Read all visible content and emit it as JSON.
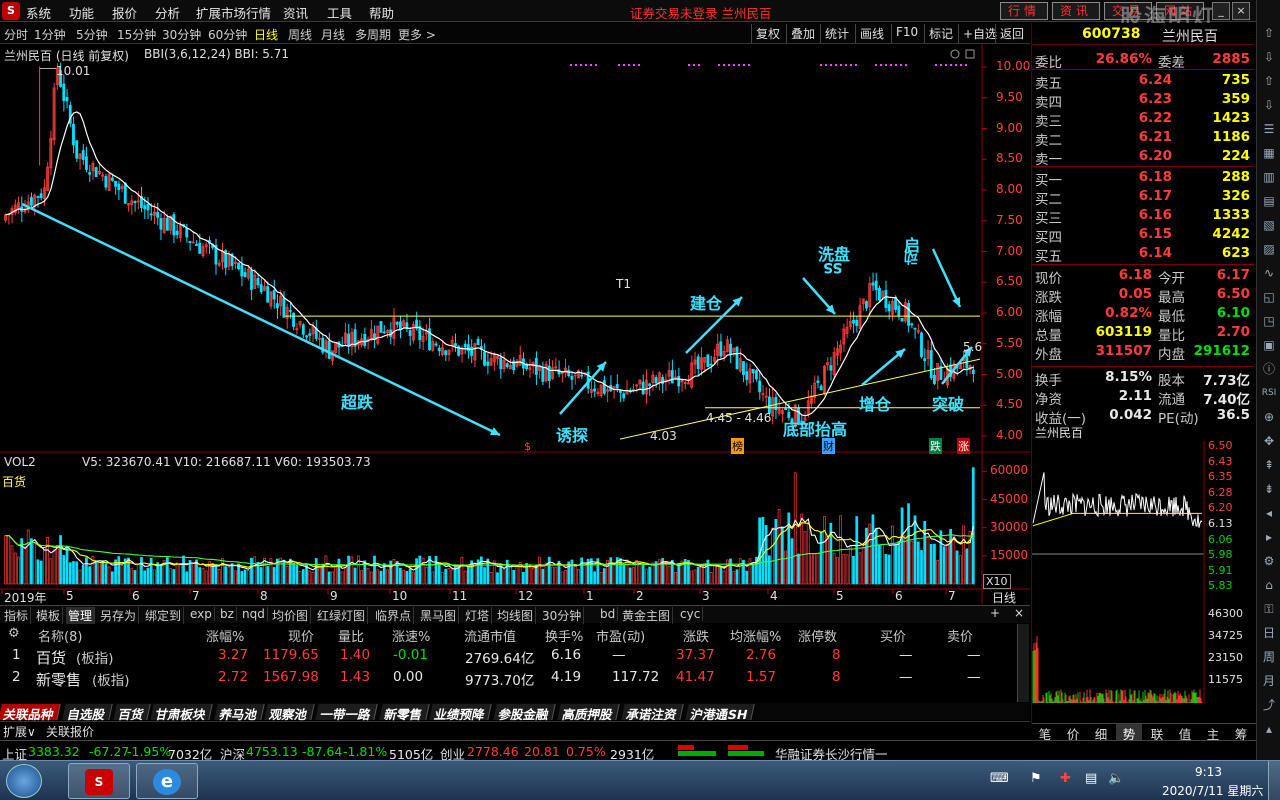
{
  "menubar": {
    "items": [
      "系统",
      "功能",
      "报价",
      "分析",
      "扩展市场行情",
      "资讯",
      "工具",
      "帮助"
    ],
    "notice": "证券交易未登录  兰州民百",
    "right_buttons": [
      "行情",
      "资讯",
      "交易",
      "网站"
    ],
    "brand": "股海明灯"
  },
  "toolbar": {
    "periods": [
      "分时",
      "1分钟",
      "5分钟",
      "15分钟",
      "30分钟",
      "60分钟",
      "日线",
      "周线",
      "月线",
      "多周期",
      "更多 >"
    ],
    "active_period": "日线",
    "buttons": [
      "复权",
      "叠加",
      "统计",
      "画线",
      "F10",
      "标记",
      "+自选",
      "返回"
    ]
  },
  "chart": {
    "title": "兰州民百 (日线 前复权)",
    "indicator": "BBI(3,6,12,24)  BBI: 5.71",
    "high_label": "10.01",
    "low_label": "4.03",
    "range_label": "4.45 - 4.46",
    "current_label": "5.6",
    "t1_label": "T1",
    "price_axis": [
      "10.00",
      "9.50",
      "9.00",
      "8.50",
      "8.00",
      "7.50",
      "7.00",
      "6.50",
      "6.00",
      "5.50",
      "5.00",
      "4.50",
      "4.00"
    ],
    "annotations": [
      "超跌",
      "诱探",
      "建仓",
      "洗盘",
      "SS",
      "启",
      "动",
      "底部抬高",
      "增仓",
      "突破"
    ],
    "markers": [
      "$",
      "榜",
      "财",
      "跌",
      "涨"
    ],
    "volume_title": "VOL2",
    "volume_values": "V5: 323670.41  V10: 216687.11  V60: 193503.73",
    "sector_label": "百货",
    "volume_axis": [
      "60000",
      "45000",
      "30000",
      "15000"
    ],
    "volume_unit": "X10",
    "x_axis": [
      "2019年",
      "5",
      "6",
      "7",
      "8",
      "9",
      "10",
      "11",
      "12",
      "1",
      "2",
      "3",
      "4",
      "5",
      "6",
      "7"
    ],
    "period_tag": "日线",
    "chart_data": {
      "type": "candlestick",
      "title": "兰州民百 (日线 前复权)",
      "ylim": [
        4.0,
        10.2
      ],
      "high": 10.01,
      "low": 4.03,
      "last_close": 6.18,
      "bbi": 5.71,
      "volume_ylim": [
        0,
        65000
      ]
    }
  },
  "quote": {
    "code": "600738",
    "name": "兰州民百",
    "weibi_label": "委比",
    "weibi_value": "26.86%",
    "weicha_label": "委差",
    "weicha_value": "2885",
    "asks": [
      {
        "label": "卖五",
        "price": "6.24",
        "vol": "735"
      },
      {
        "label": "卖四",
        "price": "6.23",
        "vol": "359"
      },
      {
        "label": "卖三",
        "price": "6.22",
        "vol": "1423"
      },
      {
        "label": "卖二",
        "price": "6.21",
        "vol": "1186"
      },
      {
        "label": "卖一",
        "price": "6.20",
        "vol": "224"
      }
    ],
    "bids": [
      {
        "label": "买一",
        "price": "6.18",
        "vol": "288"
      },
      {
        "label": "买二",
        "price": "6.17",
        "vol": "326"
      },
      {
        "label": "买三",
        "price": "6.16",
        "vol": "1333"
      },
      {
        "label": "买四",
        "price": "6.15",
        "vol": "4242"
      },
      {
        "label": "买五",
        "price": "6.14",
        "vol": "623"
      }
    ],
    "stats": [
      {
        "l1": "现价",
        "v1": "6.18",
        "l2": "今开",
        "v2": "6.17"
      },
      {
        "l1": "涨跌",
        "v1": "0.05",
        "l2": "最高",
        "v2": "6.50"
      },
      {
        "l1": "涨幅",
        "v1": "0.82%",
        "l2": "最低",
        "v2": "6.10"
      },
      {
        "l1": "总量",
        "v1": "603119",
        "l2": "量比",
        "v2": "2.70"
      },
      {
        "l1": "外盘",
        "v1": "311507",
        "l2": "内盘",
        "v2": "291612"
      }
    ],
    "stats2": [
      {
        "l1": "换手",
        "v1": "8.15%",
        "l2": "股本",
        "v2": "7.73亿"
      },
      {
        "l1": "净资",
        "v1": "2.11",
        "l2": "流通",
        "v2": "7.40亿"
      },
      {
        "l1": "收益(一)",
        "v1": "0.042",
        "l2": "PE(动)",
        "v2": "36.5"
      }
    ],
    "mini_title": "兰州民百",
    "mini_axis": [
      "6.50",
      "6.43",
      "6.35",
      "6.28",
      "6.20",
      "6.13",
      "6.06",
      "5.98",
      "5.91",
      "5.83",
      "46300",
      "34725",
      "23150",
      "11575"
    ],
    "right_tabs": [
      "笔",
      "价",
      "细",
      "势",
      "联",
      "值",
      "主",
      "筹"
    ]
  },
  "bottom": {
    "tabs": [
      "指标",
      "模板",
      "管理",
      "另存为",
      "绑定到",
      "exp",
      "bz",
      "nqd",
      "均价图",
      "红绿灯图",
      "临界点",
      "黑马图",
      "灯塔",
      "均线图",
      "30分钟",
      "bd",
      "黄金主图",
      "cyc"
    ],
    "columns": [
      "名称(8)",
      "涨幅%",
      "现价",
      "量比",
      "涨速%",
      "流通市值",
      "换手%",
      "市盈(动)",
      "涨跌",
      "均涨幅%",
      "涨停数",
      "买价",
      "卖价"
    ],
    "rows": [
      {
        "no": "1",
        "name": "百货",
        "tag": "(板指)",
        "chg": "3.27",
        "price": "1179.65",
        "lb": "1.40",
        "speed": "-0.01",
        "cap": "2769.64亿",
        "turn": "6.16",
        "pe": "—",
        "diff": "37.37",
        "avg": "2.76",
        "limit": "8",
        "bid": "—",
        "ask": "—"
      },
      {
        "no": "2",
        "name": "新零售",
        "tag": "(板指)",
        "chg": "2.72",
        "price": "1567.98",
        "lb": "1.43",
        "speed": "0.00",
        "cap": "9773.70亿",
        "turn": "4.19",
        "pe": "117.72",
        "diff": "41.47",
        "avg": "1.57",
        "limit": "8",
        "bid": "—",
        "ask": "—"
      }
    ],
    "category_tabs": [
      "关联品种",
      "自选股",
      "百货",
      "甘肃板块",
      "养马池",
      "观察池",
      "一带一路",
      "新零售",
      "业绩预降",
      "参股金融",
      "高质押股",
      "承诺注资",
      "沪港通SH"
    ],
    "sub_tabs": [
      "扩展∨",
      "关联报价"
    ]
  },
  "status": {
    "sh_label": "上证",
    "sh_val": "3383.32",
    "sh_chg": "-67.27",
    "sh_pct": "-1.95%",
    "sh_amt": "7032亿",
    "hs_label": "沪深",
    "hs_val": "4753.13",
    "hs_chg": "-87.64",
    "hs_pct": "-1.81%",
    "hs_amt": "5105亿",
    "cy_label": "创业",
    "cy_val": "2778.46",
    "cy_chg": "20.81",
    "cy_pct": "0.75%",
    "cy_amt": "2931亿",
    "broker": "华融证券长沙行情一"
  },
  "taskbar": {
    "time": "9:13",
    "date": "2020/7/11 星期六"
  },
  "colors": {
    "up": "#ff3c3c",
    "down": "#00e0ff",
    "annotation": "#40e0ff",
    "bbi": "#ffffff",
    "guide": "#ffff60"
  }
}
